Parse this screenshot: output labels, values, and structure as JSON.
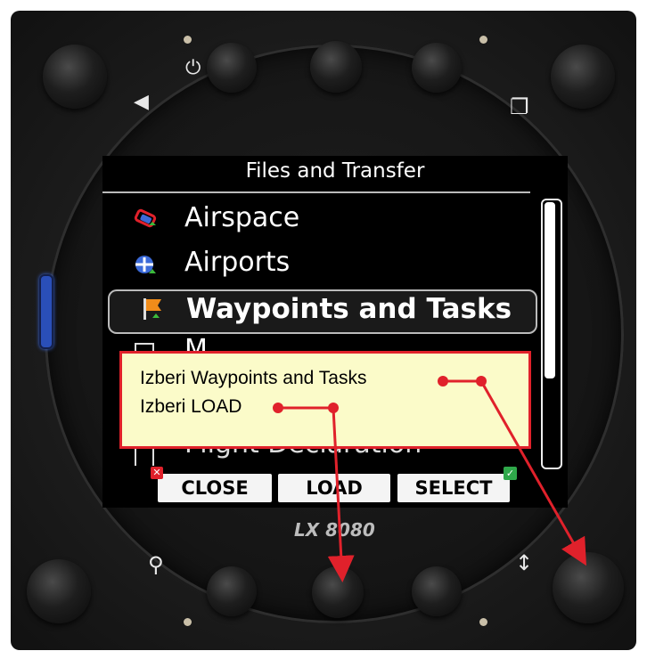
{
  "device": {
    "brand": "LX 8080"
  },
  "screen": {
    "title": "Files and Transfer",
    "items": [
      {
        "label": "Airspace",
        "icon": "airspace-icon"
      },
      {
        "label": "Airports",
        "icon": "airport-icon"
      },
      {
        "label": "Waypoints and Tasks",
        "icon": "flag-icon",
        "selected": true
      },
      {
        "label": "M",
        "icon": "map-icon"
      },
      {
        "label": "Flight Declaration",
        "icon": "declaration-icon"
      }
    ],
    "buttons": {
      "close": "CLOSE",
      "load": "LOAD",
      "select": "SELECT"
    }
  },
  "annotation": {
    "line1": "Izberi Waypoints and Tasks",
    "line2": "Izberi LOAD",
    "border_color": "#e0212b",
    "background": "#fbfbc9"
  },
  "colors": {
    "accent_lamp": "#2a4fb8",
    "arrow": "#e0212b",
    "flag": "#f08c1a"
  }
}
